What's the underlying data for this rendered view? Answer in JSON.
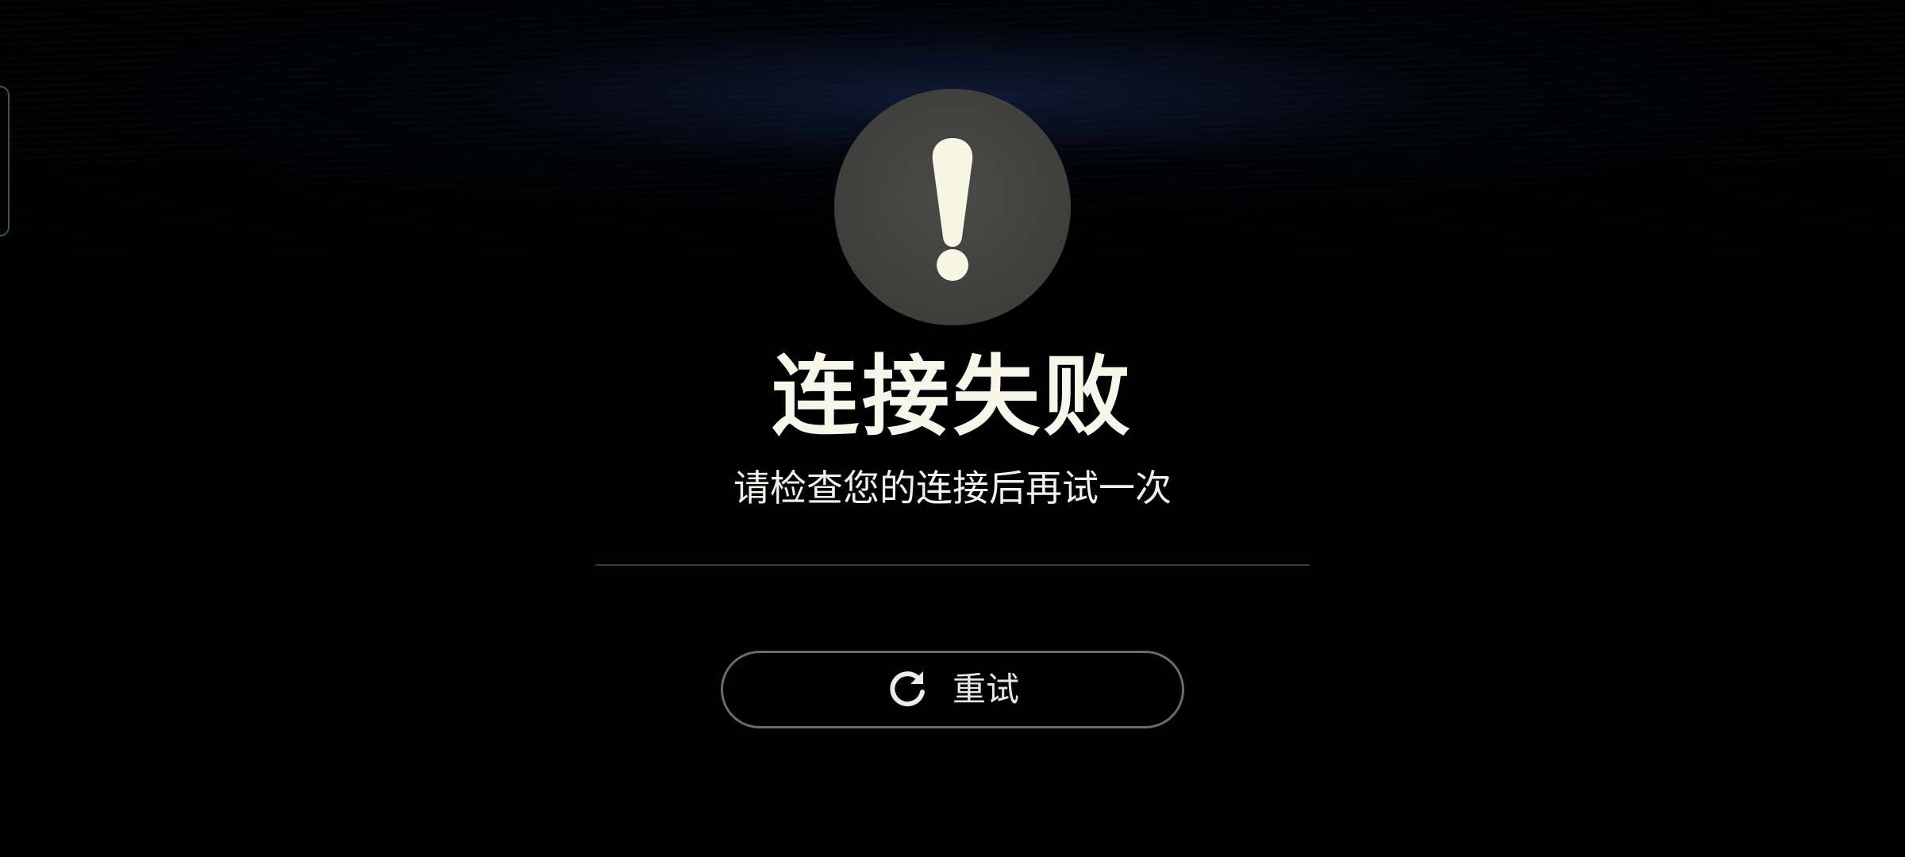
{
  "dialog": {
    "title": "连接失败",
    "message": "请检查您的连接后再试一次",
    "icon": "exclamation-icon"
  },
  "actions": {
    "retry_label": "重试",
    "retry_icon": "refresh-icon"
  },
  "colors": {
    "background": "#000000",
    "icon_circle": "#3e3e3c",
    "icon_glyph": "#f7f6e4",
    "text_primary": "#f7f6ea",
    "button_border": "#6b6b6b",
    "side_handle_border": "#2e5a5a"
  }
}
